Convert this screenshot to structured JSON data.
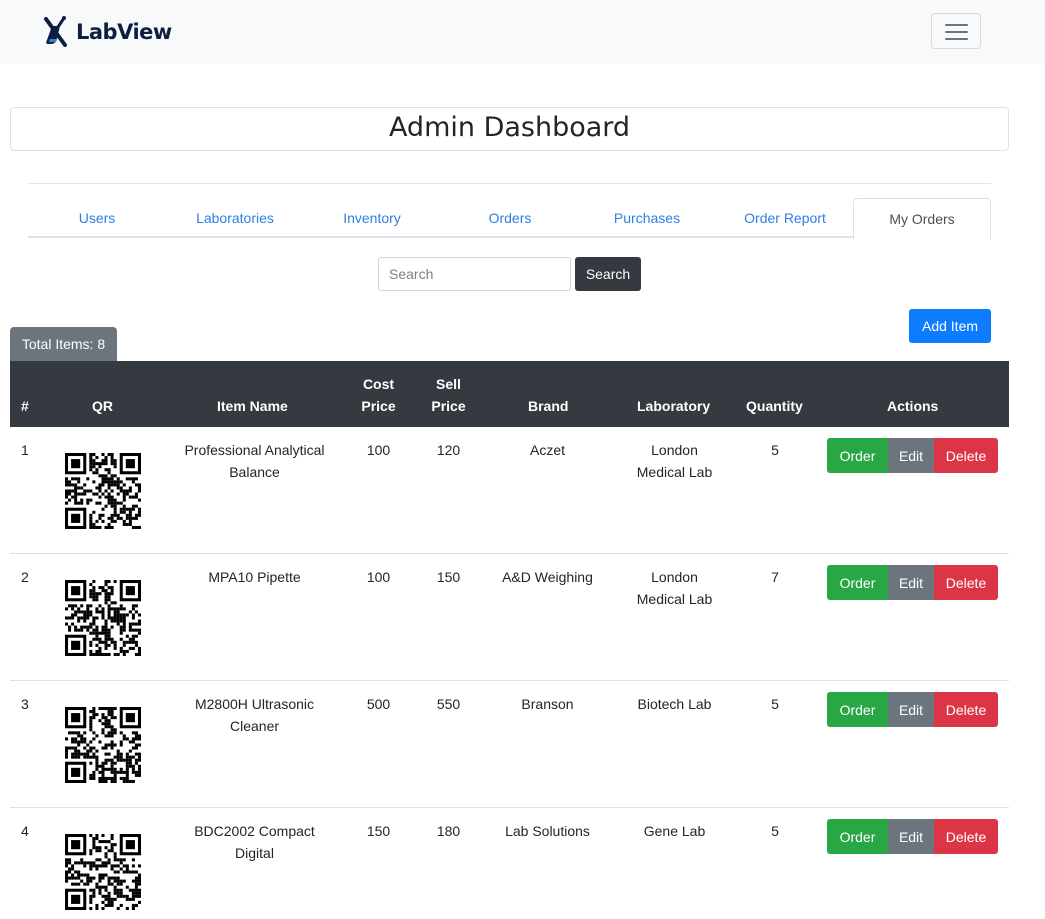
{
  "navbar": {
    "brand": "LabView"
  },
  "page": {
    "title": "Admin Dashboard"
  },
  "tabs": [
    {
      "label": "Users"
    },
    {
      "label": "Laboratories"
    },
    {
      "label": "Inventory"
    },
    {
      "label": "Orders"
    },
    {
      "label": "Purchases"
    },
    {
      "label": "Order Report"
    },
    {
      "label": "My Orders",
      "active": true
    }
  ],
  "search": {
    "placeholder": "Search",
    "button": "Search"
  },
  "total_items": "Total Items: 8",
  "add_item": "Add Item",
  "table": {
    "headers": {
      "num": "#",
      "qr": "QR",
      "item_name": "Item Name",
      "cost_price_1": "Cost",
      "cost_price_2": "Price",
      "sell_price_1": "Sell",
      "sell_price_2": "Price",
      "brand": "Brand",
      "laboratory": "Laboratory",
      "quantity": "Quantity",
      "actions": "Actions"
    },
    "rows": [
      {
        "num": "1",
        "name_1": "Professional Analytical",
        "name_2": "Balance",
        "cost": "100",
        "sell": "120",
        "brand": "Aczet",
        "lab_1": "London",
        "lab_2": "Medical Lab",
        "qty": "5"
      },
      {
        "num": "2",
        "name_1": "MPA10 Pipette",
        "name_2": "",
        "cost": "100",
        "sell": "150",
        "brand": "A&D Weighing",
        "lab_1": "London",
        "lab_2": "Medical Lab",
        "qty": "7"
      },
      {
        "num": "3",
        "name_1": "M2800H Ultrasonic",
        "name_2": "Cleaner",
        "cost": "500",
        "sell": "550",
        "brand": "Branson",
        "lab_1": "Biotech Lab",
        "lab_2": "",
        "qty": "5"
      },
      {
        "num": "4",
        "name_1": "BDC2002 Compact",
        "name_2": "Digital",
        "cost": "150",
        "sell": "180",
        "brand": "Lab Solutions",
        "lab_1": "Gene Lab",
        "lab_2": "",
        "qty": "5"
      }
    ],
    "actions": {
      "order": "Order",
      "edit": "Edit",
      "delete": "Delete"
    }
  },
  "colors": {
    "navbar_bg": "#f8f9fa",
    "link": "#2f7fe0",
    "dark": "#343a40",
    "primary": "#0d7cff",
    "success": "#28a745",
    "secondary": "#6c757d",
    "danger": "#dc3545"
  },
  "icons": {
    "brand": "microscope-flask-icon",
    "menu": "hamburger-icon",
    "qr": "qr-code-icon"
  }
}
